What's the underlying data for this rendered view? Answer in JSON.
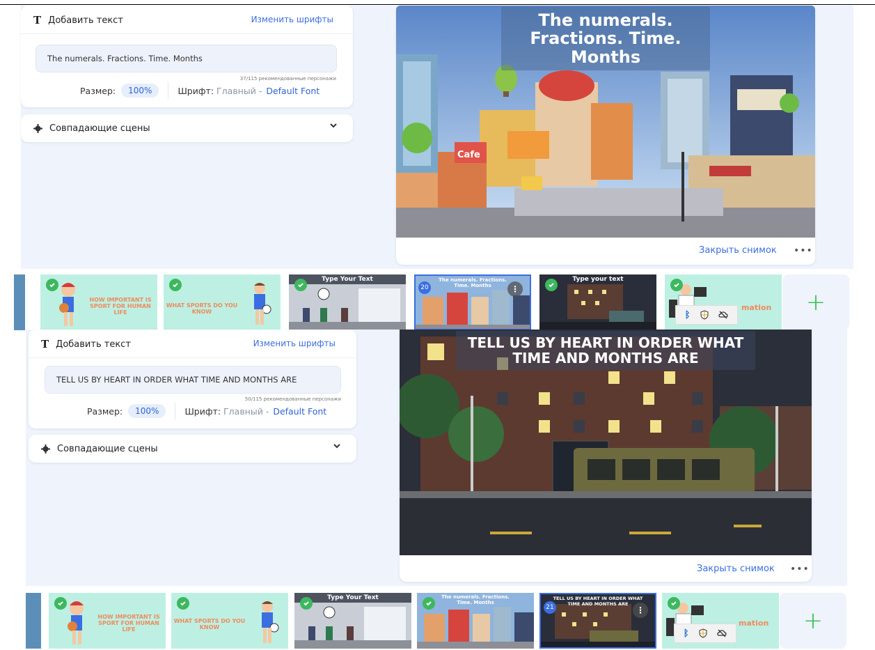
{
  "editor1": {
    "add_text_label": "Добавить текст",
    "change_fonts_label": "Изменить шрифты",
    "text_value": "The numerals. Fractions. Time. Months",
    "char_counter": "37/115 рекомендованные персонажи",
    "size_label": "Размер:",
    "size_value": "100%",
    "font_label": "Шрифт:",
    "font_main": "Главный -",
    "font_default": "Default Font",
    "matching_scenes_label": "Совпадающие сцены",
    "preview_caption": "The numerals. Fractions. Time. Months",
    "cafe_sign": "Cafe",
    "close_snapshot_label": "Закрыть снимок",
    "more_label": "•••"
  },
  "editor2": {
    "add_text_label": "Добавить текст",
    "change_fonts_label": "Изменить шрифты",
    "text_value": "TELL US BY HEART IN ORDER WHAT TIME AND MONTHS ARE",
    "char_counter": "50/115 рекомендованные персонажи",
    "size_label": "Размер:",
    "size_value": "100%",
    "font_label": "Шрифт:",
    "font_main": "Главный -",
    "font_default": "Default Font",
    "matching_scenes_label": "Совпадающие сцены",
    "preview_caption": "TELL US BY HEART IN ORDER WHAT TIME AND MONTHS ARE",
    "close_snapshot_label": "Закрыть снимок",
    "more_label": "•••"
  },
  "strip1": {
    "scene_sport_life": "HOW IMPORTANT IS SPORT FOR HUMAN LIFE",
    "scene_sports_know": "WHAT SPORTS DO YOU KNOW",
    "scene_type_text_1": "Type Your Text",
    "scene_numerals": "The numerals. Fractions. Time. Months",
    "scene_numerals_number": "20",
    "scene_type_text_2": "Type your text",
    "scene_partial": "mation",
    "add_label": "+"
  },
  "strip2": {
    "scene_sport_life": "HOW IMPORTANT IS SPORT FOR HUMAN LIFE",
    "scene_sports_know": "WHAT SPORTS DO YOU KNOW",
    "scene_type_text_1": "Type Your Text",
    "scene_numerals": "The numerals. Fractions. Time. Months",
    "scene_tell_us": "TELL US BY HEART IN ORDER WHAT TIME AND MONTHS ARE",
    "scene_tell_us_number": "21",
    "scene_partial": "mation",
    "add_label": "+"
  },
  "colors": {
    "accent_blue": "#3b6ee0",
    "check_green": "#3db85e",
    "plus_green": "#2fbf4a",
    "workspace_bg": "#eef3fc"
  }
}
